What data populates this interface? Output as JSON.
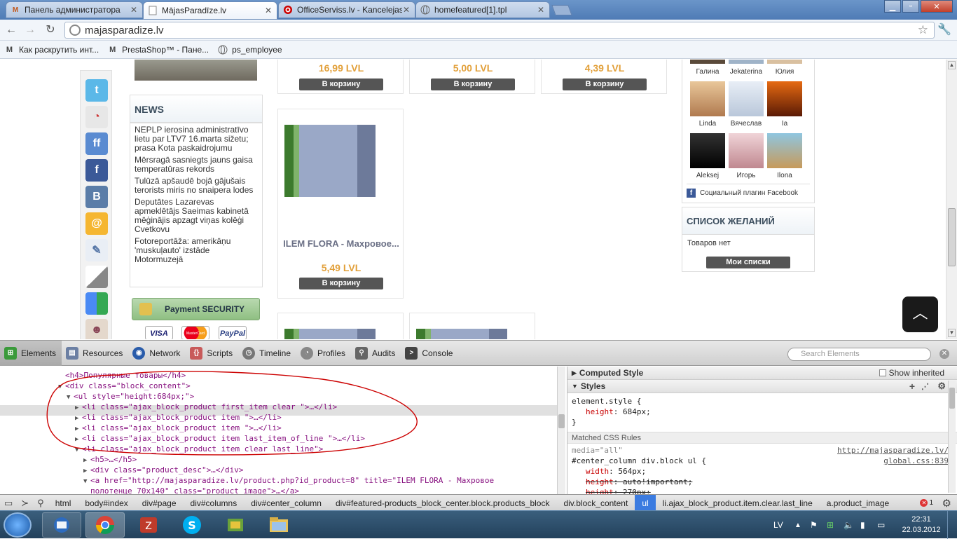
{
  "browser": {
    "tabs": [
      {
        "label": "Панель администратора",
        "favicon": "M",
        "active": false
      },
      {
        "label": "MājasParadīze.lv",
        "favicon": "page",
        "active": true
      },
      {
        "label": "OfficeServiss.lv - Kancelejas",
        "favicon": "target",
        "active": false
      },
      {
        "label": "homefeatured[1].tpl",
        "favicon": "globe",
        "active": false
      }
    ],
    "url": "majasparadize.lv",
    "bookmarks": [
      {
        "label": "Как раскрутить инт...",
        "icon": "M"
      },
      {
        "label": "PrestaShop™ - Пане...",
        "icon": "M"
      },
      {
        "label": "ps_employee",
        "icon": "globe"
      }
    ]
  },
  "page": {
    "news": {
      "title": "NEWS",
      "items": [
        "NEPLP ierosina administratīvo lietu par LTV7 16.marta sižetu; prasa Kota paskaidrojumu",
        "Mērsragā sasniegts jauns gaisa temperatūras rekords",
        "Tulūzā apšaudē bojā gājušais terorists miris no snaipera lodes",
        "Deputātes Lazarevas apmeklētājs Saeimas kabinetā mēģinājis apzagt viņas kolēģi Cvetkovu",
        "Fotoreportāža: amerikāņu 'muskuļauto' izstāde Motormuzejā"
      ]
    },
    "payment": {
      "label": "Payment SECURITY",
      "cards": [
        "VISA",
        "MasterCard",
        "PayPal"
      ]
    },
    "products_top": [
      {
        "price": "16,99 LVL",
        "button": "В корзину"
      },
      {
        "price": "5,00 LVL",
        "button": "В корзину"
      },
      {
        "price": "4,39 LVL",
        "button": "В корзину"
      }
    ],
    "product_featured": {
      "name": "ILEM FLORA - Махровое...",
      "price": "5,49 LVL",
      "button": "В корзину"
    },
    "facebook": {
      "top_names": [
        "Галина",
        "Jekaterina",
        "Юлия"
      ],
      "people": [
        {
          "name": "Linda"
        },
        {
          "name": "Вячеслав"
        },
        {
          "name": "Ia"
        },
        {
          "name": "Aleksej"
        },
        {
          "name": "Игорь"
        },
        {
          "name": "Ilona"
        }
      ],
      "plugin_label": "Социальный плагин Facebook"
    },
    "wishlist": {
      "title": "СПИСОК ЖЕЛАНИЙ",
      "empty": "Товаров нет",
      "button": "Мои списки"
    },
    "scroll_top_icon": "chevron-up-icon"
  },
  "devtools": {
    "tabs": [
      "Elements",
      "Resources",
      "Network",
      "Scripts",
      "Timeline",
      "Profiles",
      "Audits",
      "Console"
    ],
    "search_placeholder": "Search Elements",
    "dom": [
      {
        "indent": 0,
        "arrow": "",
        "html": "<h4>Популярные товары</h4>"
      },
      {
        "indent": 0,
        "arrow": "▼",
        "html": "<div class=\"block_content\">"
      },
      {
        "indent": 1,
        "arrow": "▼",
        "html": "<ul style=\"height:684px;\">"
      },
      {
        "indent": 2,
        "arrow": "▶",
        "html": "<li class=\"ajax_block_product first_item clear \">…</li>"
      },
      {
        "indent": 2,
        "arrow": "▶",
        "html": "<li class=\"ajax_block_product item  \">…</li>"
      },
      {
        "indent": 2,
        "arrow": "▶",
        "html": "<li class=\"ajax_block_product item  \">…</li>"
      },
      {
        "indent": 2,
        "arrow": "▶",
        "html": "<li class=\"ajax_block_product item last_item_of_line \">…</li>"
      },
      {
        "indent": 2,
        "arrow": "▼",
        "html": "<li class=\"ajax_block_product item clear last_line\">"
      },
      {
        "indent": 3,
        "arrow": "▶",
        "html": "<h5>…</h5>"
      },
      {
        "indent": 3,
        "arrow": "▶",
        "html": "<div class=\"product_desc\">…</div>"
      },
      {
        "indent": 3,
        "arrow": "▼",
        "html": "<a href=\"http://majasparadize.lv/product.php?id_product=8\" title=\"ILEM FLORA - Махровое"
      },
      {
        "indent": 3,
        "arrow": "",
        "html": "полотенце 70x140\" class=\"product_image\">…</a>"
      }
    ],
    "styles": {
      "computed_label": "Computed Style",
      "show_inherited": "Show inherited",
      "styles_label": "Styles",
      "element_style": "element.style {",
      "element_prop": "height",
      "element_val": "684px;",
      "close": "}",
      "matched_label": "Matched CSS Rules",
      "media": "media=\"all\"",
      "source_url": "http://majasparadize.lv/",
      "selector": "#center_column div.block ul {",
      "source_file": "global.css:839",
      "rules": [
        {
          "prop": "width",
          "val": "564px;",
          "struck": false
        },
        {
          "prop": "height",
          "val": "auto!important;",
          "struck": true
        },
        {
          "prop": "height",
          "val": "270px;",
          "struck": true
        }
      ]
    },
    "breadcrumbs": [
      "html",
      "body#index",
      "div#page",
      "div#columns",
      "div#center_column",
      "div#featured-products_block_center.block.products_block",
      "div.block_content",
      "ul",
      "li.ajax_block_product.item.clear.last_line",
      "a.product_image"
    ],
    "breadcrumb_selected": "ul",
    "error_count": "1"
  },
  "taskbar": {
    "lang": "LV",
    "time": "22:31",
    "date": "22.03.2012"
  },
  "colors": {
    "price": "#e2a03a",
    "button": "#555555",
    "annotation": "#cc0000",
    "selected_crumb": "#3b7be0"
  }
}
